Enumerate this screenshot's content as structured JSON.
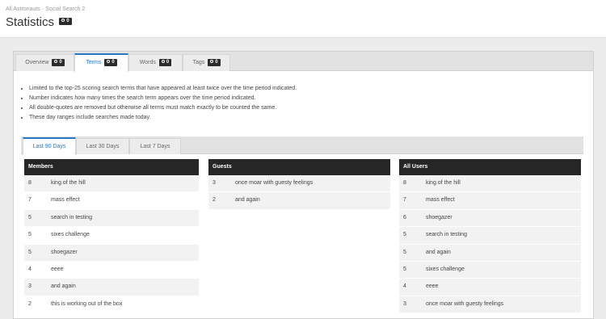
{
  "breadcrumb": {
    "parent": "All Astronauts",
    "separator": "·",
    "current": "Social Search 2"
  },
  "page": {
    "title": "Statistics",
    "badge": "0"
  },
  "tabs": [
    {
      "label": "Overview",
      "badge": "0"
    },
    {
      "label": "Terms",
      "badge": "0"
    },
    {
      "label": "Words",
      "badge": "0"
    },
    {
      "label": "Tags",
      "badge": "0"
    }
  ],
  "notes": [
    "Limited to the top-25 scoring search terms that have appeared at least twice over the time period indicated.",
    "Number indicates how many times the search term appears over the time period indicated.",
    "All double-quotes are removed but otherwise all terms must match exactly to be counted the same.",
    "These day ranges include searches made today."
  ],
  "range_tabs": [
    "Last 90 Days",
    "Last 30 Days",
    "Last 7 Days"
  ],
  "columns": {
    "members": {
      "header": "Members",
      "rows": [
        {
          "count": "8",
          "term": "king of the hill"
        },
        {
          "count": "7",
          "term": "mass effect"
        },
        {
          "count": "5",
          "term": "search in testing"
        },
        {
          "count": "5",
          "term": "sixes challenge"
        },
        {
          "count": "5",
          "term": "shoegazer"
        },
        {
          "count": "4",
          "term": "eeee"
        },
        {
          "count": "3",
          "term": "and again"
        },
        {
          "count": "2",
          "term": "this is working out of the box"
        }
      ]
    },
    "guests": {
      "header": "Guests",
      "rows": [
        {
          "count": "3",
          "term": "once moar with guesty feelings"
        },
        {
          "count": "2",
          "term": "and again"
        }
      ]
    },
    "all": {
      "header": "All Users",
      "rows": [
        {
          "count": "8",
          "term": "king of the hill"
        },
        {
          "count": "7",
          "term": "mass effect"
        },
        {
          "count": "6",
          "term": "shoegazer"
        },
        {
          "count": "5",
          "term": "search in testing"
        },
        {
          "count": "5",
          "term": "and again"
        },
        {
          "count": "5",
          "term": "sixes challenge"
        },
        {
          "count": "4",
          "term": "eeee"
        },
        {
          "count": "3",
          "term": "once moar with guesty feelings"
        }
      ]
    }
  }
}
